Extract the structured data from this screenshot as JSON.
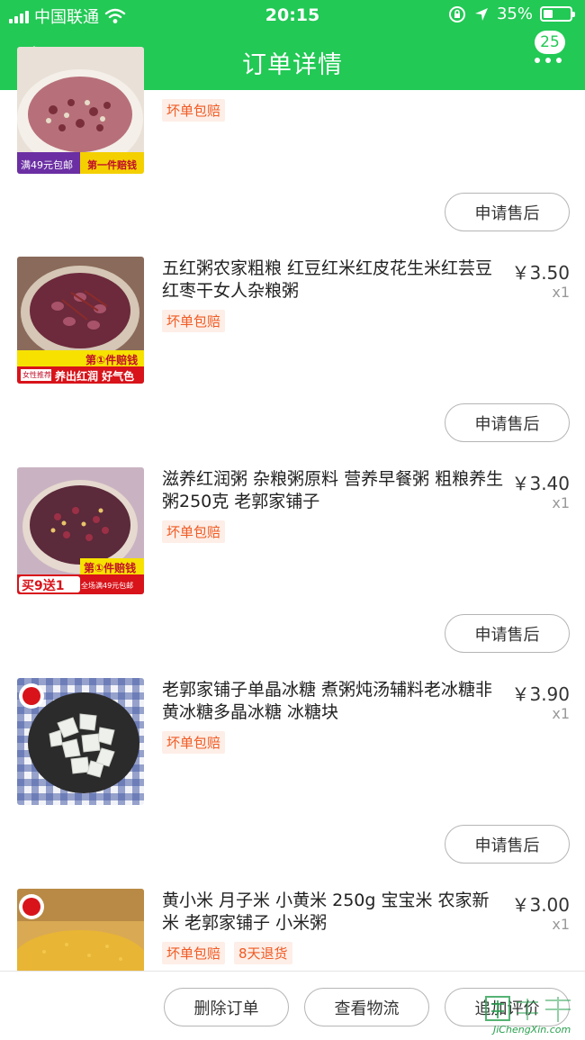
{
  "status_bar": {
    "carrier": "中国联通",
    "time": "20:15",
    "battery": "35%",
    "battery_level": 0.35
  },
  "header": {
    "title": "订单详情",
    "badge_count": "25"
  },
  "items": [
    {
      "name": "",
      "price": "",
      "qty": "",
      "tags": [
        "坏单包赔"
      ],
      "after_sale_label": "申请售后",
      "thumb_label_left": "满49元包邮",
      "thumb_label_right": "第一件赔钱"
    },
    {
      "name": "五红粥农家粗粮 红豆红米红皮花生米红芸豆红枣干女人杂粮粥",
      "price": "￥3.50",
      "qty": "x1",
      "tags": [
        "坏单包赔"
      ],
      "after_sale_label": "申请售后",
      "thumb_label_top": "第①件赔钱",
      "thumb_label_small": "女性推荐",
      "thumb_label_bottom": "养出红润 好气色"
    },
    {
      "name": "滋养红润粥 杂粮粥原料 营养早餐粥 粗粮养生粥250克 老郭家铺子",
      "price": "￥3.40",
      "qty": "x1",
      "tags": [
        "坏单包赔"
      ],
      "after_sale_label": "申请售后",
      "thumb_label_top": "第①件赔钱",
      "thumb_label_bottom": "买9送1",
      "thumb_label_small": "全场满49元包邮"
    },
    {
      "name": "老郭家铺子单晶冰糖 煮粥炖汤辅料老冰糖非黄冰糖多晶冰糖 冰糖块",
      "price": "￥3.90",
      "qty": "x1",
      "tags": [
        "坏单包赔"
      ],
      "after_sale_label": "申请售后"
    },
    {
      "name": "黄小米 月子米 小黄米 250g 宝宝米 农家新米 老郭家铺子 小米粥",
      "price": "￥3.00",
      "qty": "x1",
      "tags": [
        "坏单包赔",
        "8天退货"
      ]
    }
  ],
  "bottom_bar": {
    "delete_label": "删除订单",
    "logistics_label": "查看物流",
    "review_label": "追加评价"
  },
  "watermark": {
    "text": "JiChengXin.com"
  },
  "colors": {
    "brand_green": "#22c955",
    "tag_text": "#f05a23",
    "tag_bg": "#fdeee7"
  }
}
